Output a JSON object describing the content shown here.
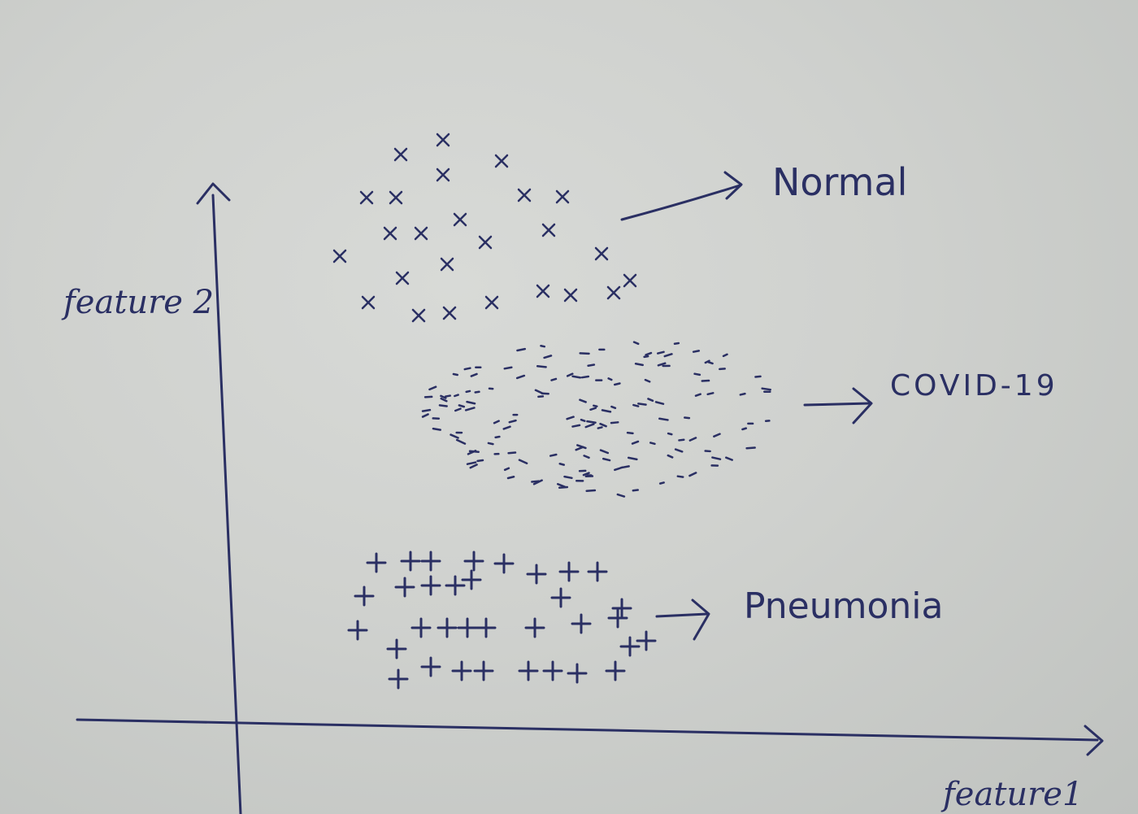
{
  "axes": {
    "x_label": "feature1",
    "y_label": "feature 2"
  },
  "clusters": [
    {
      "name": "Normal",
      "marker": "x-marker"
    },
    {
      "name": "COVID-19",
      "marker": "dash-marker"
    },
    {
      "name": "Pneumonia",
      "marker": "plus-marker"
    }
  ],
  "colors": {
    "ink": "#2a2f63",
    "paper": "#cfd1ce"
  }
}
